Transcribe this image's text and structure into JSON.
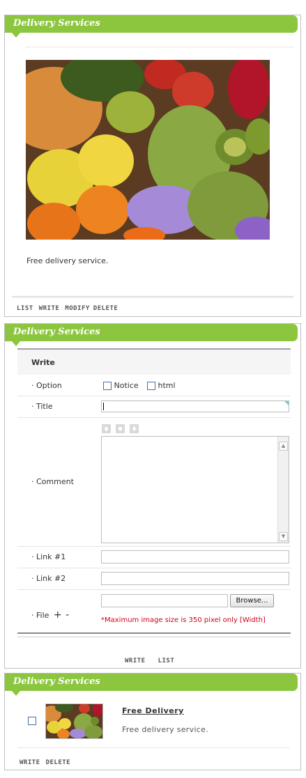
{
  "board_title": "Delivery Services",
  "view": {
    "content": "Free delivery service.",
    "actions": [
      "LIST",
      "WRITE",
      "MODIFY",
      "DELETE"
    ]
  },
  "write": {
    "heading": "Write",
    "option_label": "· Option",
    "options": [
      "Notice",
      "html"
    ],
    "title_label": "· Title",
    "title_value": "",
    "comment_label": "· Comment",
    "link1_label": "· Link #1",
    "link2_label": "· Link #2",
    "file_label": "· File",
    "file_add": "+",
    "file_remove": "-",
    "browse_label": "Browse...",
    "size_note": "*Maximum image size is 350 pixel only [Width]",
    "actions": [
      "WRITE",
      "LIST"
    ]
  },
  "list": {
    "item_title": "Free Delivery",
    "item_text": "Free delivery service.",
    "actions": [
      "WRITE",
      "DELETE"
    ]
  },
  "colors": {
    "header": "#8cc63f",
    "note": "#d0021b"
  }
}
